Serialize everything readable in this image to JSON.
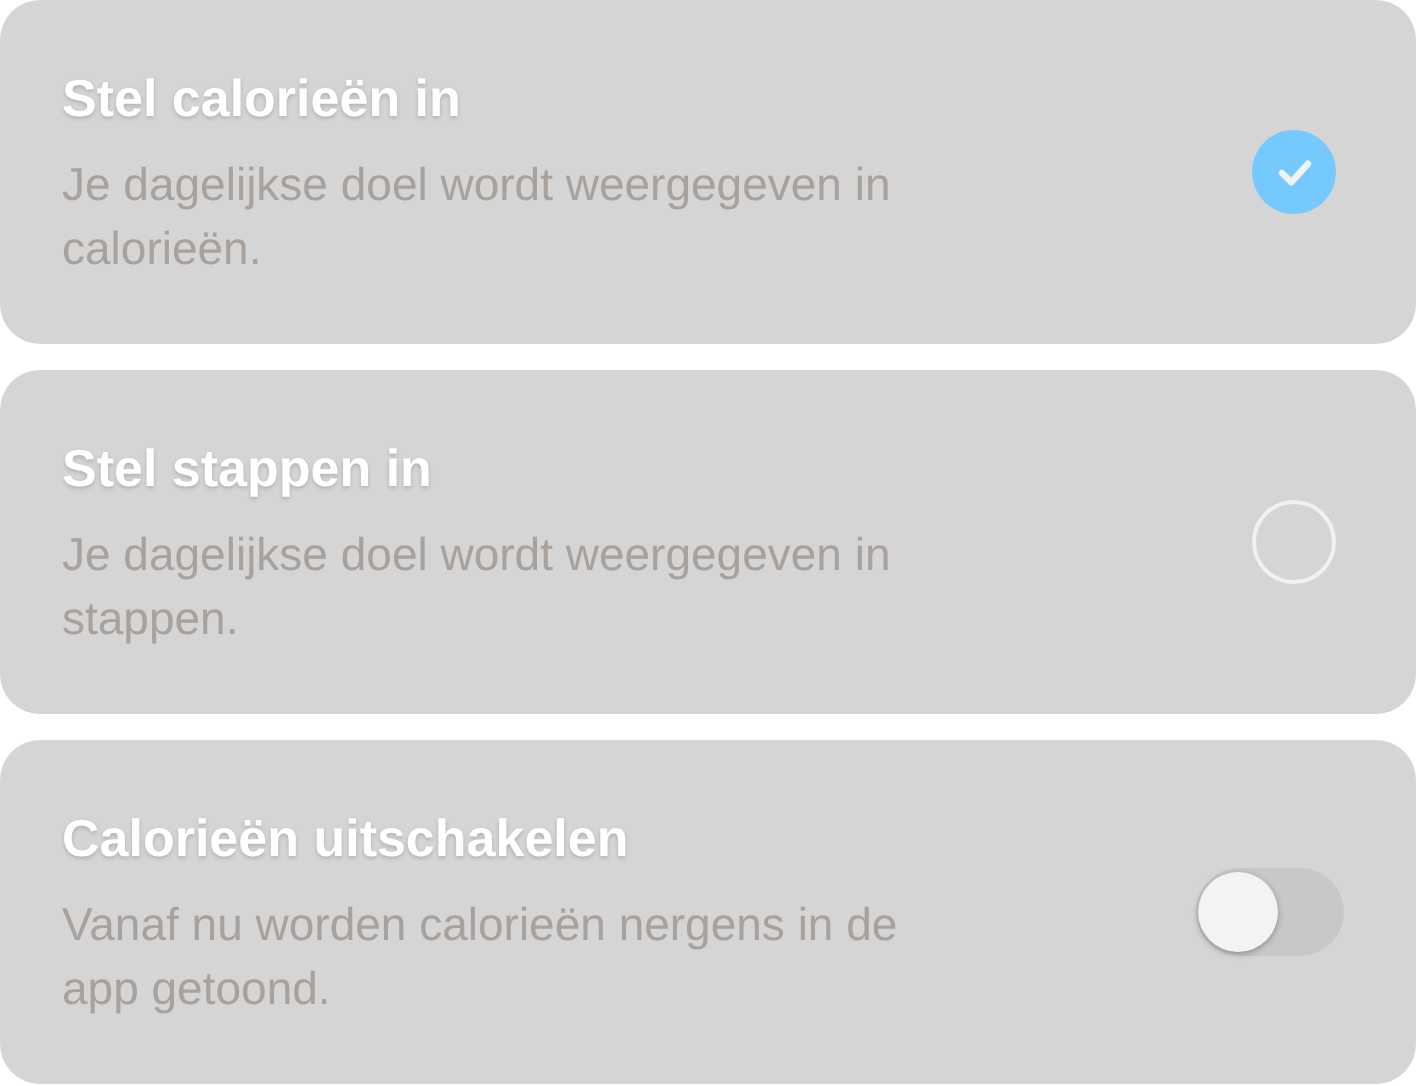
{
  "options": [
    {
      "kind": "radio",
      "title": "Stel calorieën in",
      "description": "Je dagelijkse doel wordt weergegeven in calorieën.",
      "selected": true
    },
    {
      "kind": "radio",
      "title": "Stel stappen in",
      "description": "Je dagelijkse doel wordt weergegeven in stappen.",
      "selected": false
    },
    {
      "kind": "toggle",
      "title": "Calorieën uitschakelen",
      "description": "Vanaf nu worden calorieën nergens in de app getoond.",
      "on": false
    }
  ]
}
